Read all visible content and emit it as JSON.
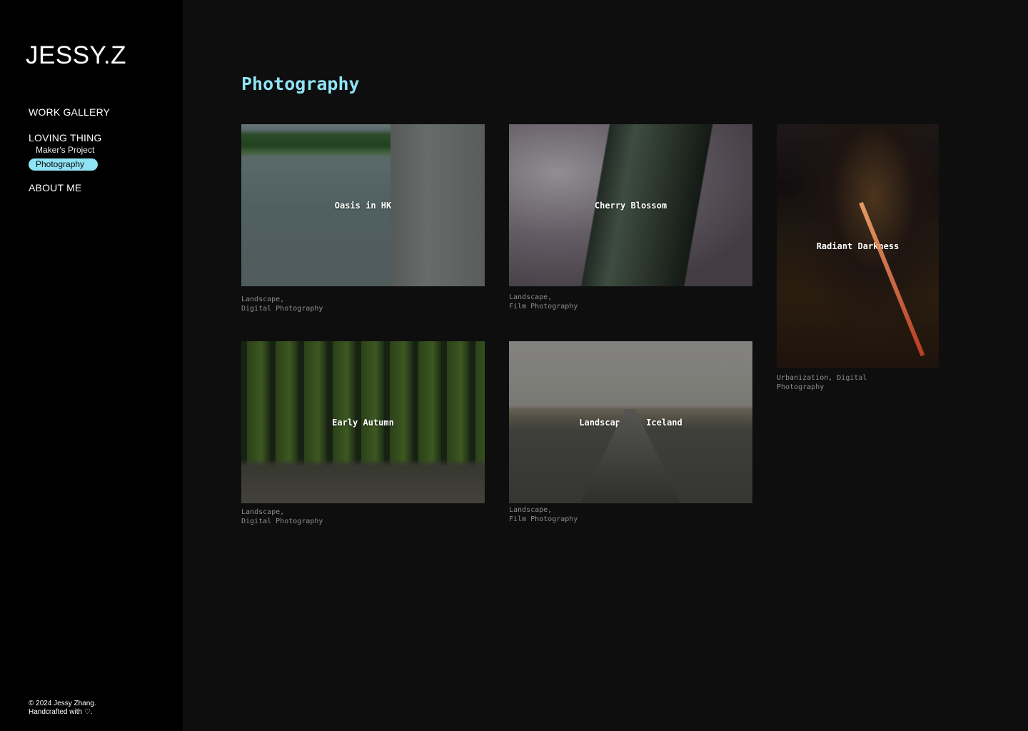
{
  "sidebar": {
    "logo": "JESSY.Z",
    "nav": {
      "work_gallery": "WORK GALLERY",
      "loving_thing": "LOVING THING",
      "makers_project": "Maker's Project",
      "photography": "Photography",
      "about_me": "ABOUT ME"
    },
    "footer": {
      "line1": "© 2024 Jessy Zhang.",
      "line2": "Handcrafted with ♡."
    }
  },
  "main": {
    "page_title": "Photography",
    "projects": [
      {
        "title": "Oasis in HK",
        "tags_line1": "Landscape,",
        "tags_line2": "Digital Photography"
      },
      {
        "title": "Cherry Blossom",
        "tags_line1": "Landscape,",
        "tags_line2": "Film Photography"
      },
      {
        "title": "Radiant Darkness",
        "tags_line1": "Urbanization, Digital",
        "tags_line2": "Photography"
      },
      {
        "title": "Early Autumn",
        "tags_line1": "Landscape,",
        "tags_line2": "Digital Photography"
      },
      {
        "title": "Landscape of Iceland",
        "tags_line1": "Landscape,",
        "tags_line2": "Film Photography"
      }
    ]
  },
  "colors": {
    "accent": "#8fe3f5",
    "sidebar_bg": "#000000",
    "main_bg": "#0e0e0e",
    "tag_text": "#8d8d8d"
  }
}
